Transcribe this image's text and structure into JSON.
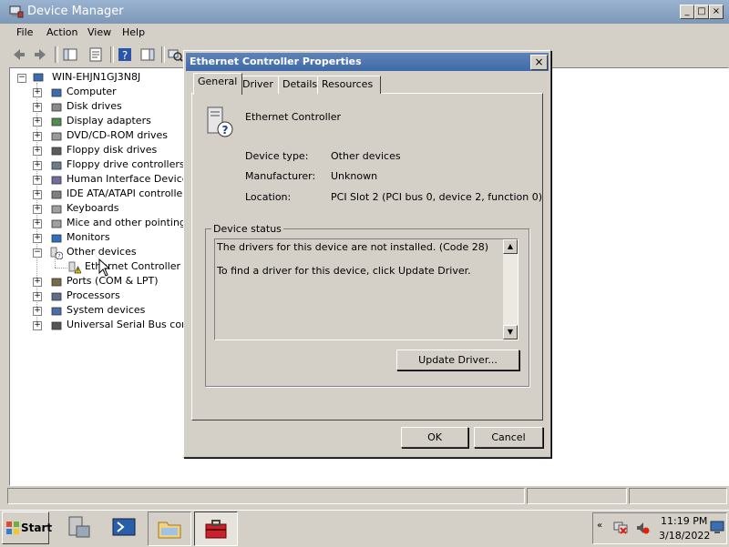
{
  "main_window": {
    "title": "Device Manager",
    "menu": [
      "File",
      "Action",
      "View",
      "Help"
    ],
    "tree": {
      "root": "WIN-EHJN1GJ3N8J",
      "items": [
        {
          "label": "Computer",
          "icon": "computer-icon",
          "expanded": false
        },
        {
          "label": "Disk drives",
          "icon": "disk-drive-icon",
          "expanded": false
        },
        {
          "label": "Display adapters",
          "icon": "display-adapter-icon",
          "expanded": false
        },
        {
          "label": "DVD/CD-ROM drives",
          "icon": "dvd-drive-icon",
          "expanded": false
        },
        {
          "label": "Floppy disk drives",
          "icon": "floppy-disk-icon",
          "expanded": false
        },
        {
          "label": "Floppy drive controllers",
          "icon": "floppy-controller-icon",
          "expanded": false
        },
        {
          "label": "Human Interface Devices",
          "icon": "hid-icon",
          "expanded": false
        },
        {
          "label": "IDE ATA/ATAPI controllers",
          "icon": "ide-controller-icon",
          "expanded": false
        },
        {
          "label": "Keyboards",
          "icon": "keyboard-icon",
          "expanded": false
        },
        {
          "label": "Mice and other pointing devices",
          "icon": "mouse-icon",
          "expanded": false
        },
        {
          "label": "Monitors",
          "icon": "monitor-icon",
          "expanded": false
        },
        {
          "label": "Other devices",
          "icon": "unknown-device-icon",
          "expanded": true
        },
        {
          "label": "Ethernet Controller",
          "icon": "warning-device-icon",
          "child": true
        },
        {
          "label": "Ports (COM & LPT)",
          "icon": "port-icon",
          "expanded": false
        },
        {
          "label": "Processors",
          "icon": "processor-icon",
          "expanded": false
        },
        {
          "label": "System devices",
          "icon": "system-device-icon",
          "expanded": false
        },
        {
          "label": "Universal Serial Bus controllers",
          "icon": "usb-icon",
          "expanded": false
        }
      ]
    }
  },
  "dialog": {
    "title": "Ethernet Controller Properties",
    "tabs": [
      "General",
      "Driver",
      "Details",
      "Resources"
    ],
    "active_tab": "General",
    "device_name": "Ethernet Controller",
    "fields": [
      {
        "label": "Device type:",
        "value": "Other devices"
      },
      {
        "label": "Manufacturer:",
        "value": "Unknown"
      },
      {
        "label": "Location:",
        "value": "PCI Slot 2 (PCI bus 0, device 2, function 0)"
      }
    ],
    "device_status": {
      "legend": "Device status",
      "line1": "The drivers for this device are not installed. (Code 28)",
      "line2": "To find a driver for this device, click Update Driver."
    },
    "update_driver_label": "Update Driver...",
    "ok_label": "OK",
    "cancel_label": "Cancel"
  },
  "taskbar": {
    "start_label": "Start",
    "clock_time": "11:19 PM",
    "clock_date": "3/18/2022"
  },
  "colors": {
    "title_active": "#3f6aa8",
    "title_inactive": "#7d98b7",
    "face": "#d4d0c8"
  }
}
